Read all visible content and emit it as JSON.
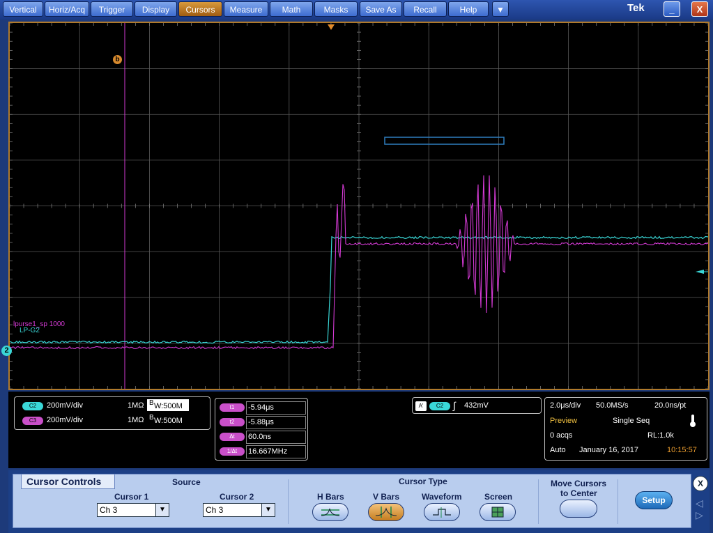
{
  "menu": {
    "items": [
      "Vertical",
      "Horiz/Acq",
      "Trigger",
      "Display",
      "Cursors",
      "Measure",
      "Math",
      "Masks",
      "Save As",
      "Recall",
      "Help"
    ],
    "active_index": 4,
    "more_label": "▼",
    "brand": "Tek",
    "minimize_label": "_",
    "close_label": "X"
  },
  "screen": {
    "cursor_marker": "b",
    "label_math": "lpurse1_sp 1000",
    "label_ref": "LP-G2",
    "ch_marker": "2",
    "colors": {
      "cyan": "#3ad7d7",
      "magenta": "#d43ad4",
      "grid": "#6f6f6f",
      "frame": "#b07a2c",
      "selection": "#2f7fbf"
    }
  },
  "channels": [
    {
      "badge": "C2",
      "scale": "200mV/div",
      "impedance": "1MΩ",
      "bw": "W:500M",
      "bw_prefix": "B",
      "badge_color": "#3ad7d7"
    },
    {
      "badge": "C3",
      "scale": "200mV/div",
      "impedance": "1MΩ",
      "bw": "W:500M",
      "bw_prefix": "B",
      "badge_color": "#c94fc9"
    }
  ],
  "cursor_readout": [
    {
      "label": "t1",
      "value": "-5.94μs"
    },
    {
      "label": "t2",
      "value": "-5.88μs"
    },
    {
      "label": "Δt",
      "value": "60.0ns"
    },
    {
      "label": "1/Δt",
      "value": "16.667MHz"
    }
  ],
  "trigger": {
    "badge_a": "A'",
    "badge_ch": "C2",
    "slope": "∫",
    "level": "432mV"
  },
  "acquisition": {
    "timebase": "2.0μs/div",
    "sample_rate": "50.0MS/s",
    "resolution": "20.0ns/pt",
    "mode": "Preview",
    "seq": "Single Seq",
    "acqs": "0 acqs",
    "record_length": "RL:1.0k",
    "trigger_mode": "Auto",
    "date": "January 16, 2017",
    "time": "10:15:57"
  },
  "controls": {
    "title": "Cursor Controls",
    "source_label": "Source",
    "cursor1_label": "Cursor 1",
    "cursor1_value": "Ch 3",
    "cursor2_label": "Cursor 2",
    "cursor2_value": "Ch 3",
    "type_label": "Cursor Type",
    "types": [
      "H Bars",
      "V Bars",
      "Waveform",
      "Screen"
    ],
    "active_type": 1,
    "move_label_1": "Move Cursors",
    "move_label_2": "to Center",
    "setup_label": "Setup",
    "close_label": "X"
  }
}
